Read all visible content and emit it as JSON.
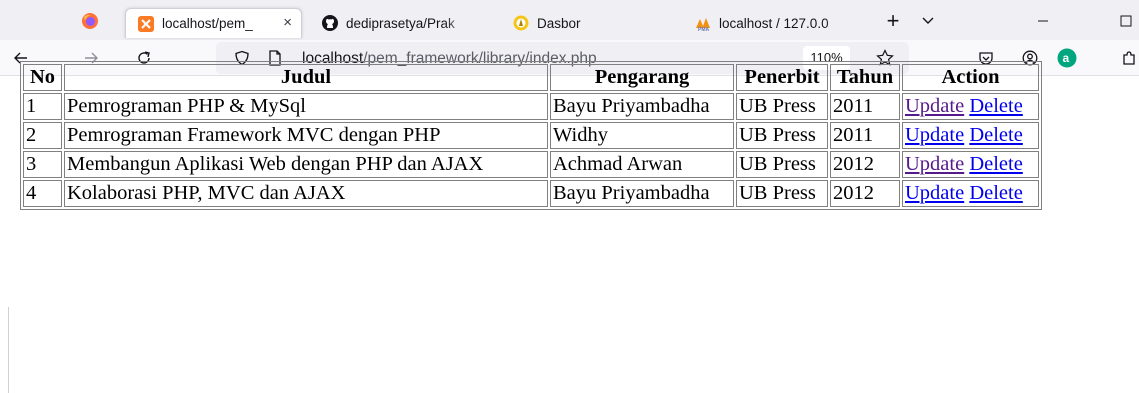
{
  "browser": {
    "tabs": [
      {
        "label": "localhost/pem_",
        "active": true
      },
      {
        "label": "dediprasetya/Prak",
        "active": false
      },
      {
        "label": "Dasbor",
        "active": false
      },
      {
        "label": "localhost / 127.0.0",
        "active": false
      }
    ],
    "tab_close_glyph": "×",
    "new_tab_glyph": "+",
    "list_tabs_glyph": "⌄",
    "url_host": "localhost",
    "url_path": "/pem_framework/library/index.php",
    "zoom": "110%"
  },
  "table": {
    "headers": [
      "No",
      "Judul",
      "Pengarang",
      "Penerbit",
      "Tahun",
      "Action"
    ],
    "update_label": "Update",
    "delete_label": "Delete",
    "rows": [
      {
        "no": "1",
        "judul": "Pemrograman PHP & MySql",
        "pengarang": "Bayu Priyambadha",
        "penerbit": "UB Press",
        "tahun": "2011",
        "update_visited": true
      },
      {
        "no": "2",
        "judul": "Pemrograman Framework MVC dengan PHP",
        "pengarang": "Widhy",
        "penerbit": "UB Press",
        "tahun": "2011",
        "update_visited": false
      },
      {
        "no": "3",
        "judul": "Membangun Aplikasi Web dengan PHP dan AJAX",
        "pengarang": "Achmad Arwan",
        "penerbit": "UB Press",
        "tahun": "2012",
        "update_visited": true
      },
      {
        "no": "4",
        "judul": "Kolaborasi PHP, MVC dan AJAX",
        "pengarang": "Bayu Priyambadha",
        "penerbit": "UB Press",
        "tahun": "2012",
        "update_visited": false
      }
    ]
  },
  "colors": {
    "link": "#0000ee",
    "visited_link": "#551a8b",
    "border": "#808080",
    "tabstrip": "#f0f0f4"
  },
  "icons": [
    "firefox-icon",
    "xampp-icon",
    "github-icon",
    "dashboard-icon",
    "phpmyadmin-icon",
    "back-arrow-icon",
    "forward-arrow-icon",
    "reload-icon",
    "shield-icon",
    "page-icon",
    "bookmark-star-icon",
    "pocket-icon",
    "account-icon",
    "extension-icon",
    "puzzle-icon"
  ]
}
